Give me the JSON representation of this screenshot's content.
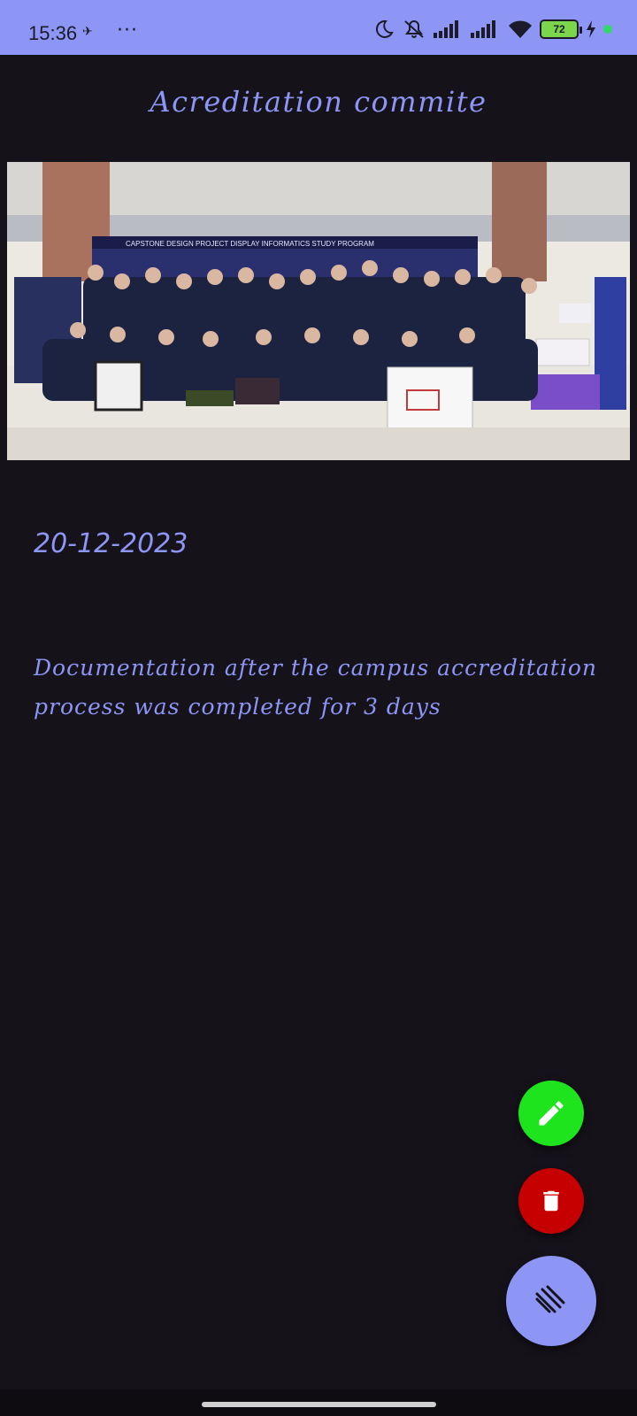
{
  "status_bar": {
    "time": "15:36",
    "dots": "···",
    "battery": "72"
  },
  "note": {
    "title": "Acreditation commite",
    "date": "20-12-2023",
    "description": "Documentation after the campus accreditation process was completed for 3 days"
  },
  "photo": {
    "banner_text": "CAPSTONE DESIGN PROJECT DISPLAY INFORMATICS STUDY PROGRAM"
  },
  "actions": {
    "edit_icon": "pencil-icon",
    "delete_icon": "trash-icon",
    "menu_icon": "menu-icon"
  },
  "colors": {
    "accent": "#8d95f5",
    "background": "#15121a",
    "edit": "#1de41d",
    "delete": "#c60000"
  }
}
